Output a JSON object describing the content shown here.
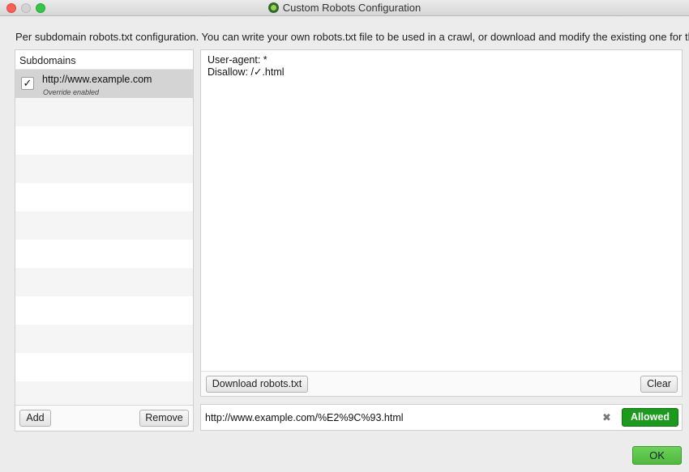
{
  "window": {
    "title": "Custom Robots Configuration"
  },
  "description": "Per subdomain robots.txt configuration. You can write your own robots.txt file to be used in a crawl, or download and modify the existing one for the site",
  "subdomains": {
    "header": "Subdomains",
    "items": [
      {
        "url": "http://www.example.com",
        "status": "Override enabled",
        "checked": true,
        "check_glyph": "✓"
      }
    ],
    "add_label": "Add",
    "remove_label": "Remove"
  },
  "editor": {
    "line1": "User-agent: *",
    "line2": "Disallow: /✓.html",
    "download_label": "Download robots.txt",
    "clear_label": "Clear"
  },
  "tester": {
    "url": "http://www.example.com/%E2%9C%93.html",
    "clear_glyph": "✖",
    "result_label": "Allowed",
    "result_color": "#1b9b1b"
  },
  "ok_label": "OK"
}
